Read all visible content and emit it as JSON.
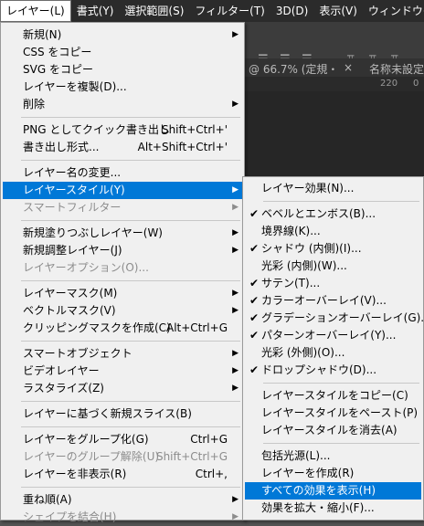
{
  "menubar": {
    "items": [
      "レイヤー(L)",
      "書式(Y)",
      "選択範囲(S)",
      "フィルター(T)",
      "3D(D)",
      "表示(V)",
      "ウィンドウ(W)"
    ]
  },
  "background": {
    "doc_tab": "@ 66.7% (定規・",
    "doc_tab2": "名称未設定",
    "ruler_220": "220",
    "ruler_0": "0"
  },
  "main_menu": [
    {
      "label": "新規(N)",
      "arrow": true
    },
    {
      "label": "CSS をコピー"
    },
    {
      "label": "SVG をコピー"
    },
    {
      "label": "レイヤーを複製(D)..."
    },
    {
      "label": "削除",
      "arrow": true
    },
    {
      "sep": true
    },
    {
      "label": "PNG としてクイック書き出し",
      "shortcut": "Shift+Ctrl+'"
    },
    {
      "label": "書き出し形式...",
      "shortcut": "Alt+Shift+Ctrl+'"
    },
    {
      "sep": true
    },
    {
      "label": "レイヤー名の変更..."
    },
    {
      "label": "レイヤースタイル(Y)",
      "arrow": true,
      "highlight": true
    },
    {
      "label": "スマートフィルター",
      "arrow": true,
      "disabled": true
    },
    {
      "sep": true
    },
    {
      "label": "新規塗りつぶしレイヤー(W)",
      "arrow": true
    },
    {
      "label": "新規調整レイヤー(J)",
      "arrow": true
    },
    {
      "label": "レイヤーオプション(O)...",
      "disabled": true
    },
    {
      "sep": true
    },
    {
      "label": "レイヤーマスク(M)",
      "arrow": true
    },
    {
      "label": "ベクトルマスク(V)",
      "arrow": true
    },
    {
      "label": "クリッピングマスクを作成(C)",
      "shortcut": "Alt+Ctrl+G"
    },
    {
      "sep": true
    },
    {
      "label": "スマートオブジェクト",
      "arrow": true
    },
    {
      "label": "ビデオレイヤー",
      "arrow": true
    },
    {
      "label": "ラスタライズ(Z)",
      "arrow": true
    },
    {
      "sep": true
    },
    {
      "label": "レイヤーに基づく新規スライス(B)"
    },
    {
      "sep": true
    },
    {
      "label": "レイヤーをグループ化(G)",
      "shortcut": "Ctrl+G"
    },
    {
      "label": "レイヤーのグループ解除(U)",
      "shortcut": "Shift+Ctrl+G",
      "disabled": true
    },
    {
      "label": "レイヤーを非表示(R)",
      "shortcut": "Ctrl+,"
    },
    {
      "sep": true
    },
    {
      "label": "重ね順(A)",
      "arrow": true
    },
    {
      "label": "シェイプを結合(H)",
      "arrow": true,
      "disabled": true
    }
  ],
  "sub_menu": [
    {
      "label": "レイヤー効果(N)..."
    },
    {
      "sep": true
    },
    {
      "label": "ベベルとエンボス(B)...",
      "checked": true
    },
    {
      "label": "境界線(K)..."
    },
    {
      "label": "シャドウ (内側)(I)...",
      "checked": true
    },
    {
      "label": "光彩 (内側)(W)..."
    },
    {
      "label": "サテン(T)...",
      "checked": true
    },
    {
      "label": "カラーオーバーレイ(V)...",
      "checked": true
    },
    {
      "label": "グラデーションオーバーレイ(G)...",
      "checked": true
    },
    {
      "label": "パターンオーバーレイ(Y)...",
      "checked": true
    },
    {
      "label": "光彩 (外側)(O)..."
    },
    {
      "label": "ドロップシャドウ(D)...",
      "checked": true
    },
    {
      "sep": true
    },
    {
      "label": "レイヤースタイルをコピー(C)"
    },
    {
      "label": "レイヤースタイルをペースト(P)"
    },
    {
      "label": "レイヤースタイルを消去(A)"
    },
    {
      "sep": true
    },
    {
      "label": "包括光源(L)..."
    },
    {
      "label": "レイヤーを作成(R)"
    },
    {
      "label": "すべての効果を表示(H)",
      "highlight": true
    },
    {
      "label": "効果を拡大・縮小(F)..."
    }
  ],
  "colors": {
    "highlight": "#0078d7",
    "menu_bg": "#f0f0f0",
    "menubar_bg": "#2b2b2b"
  }
}
